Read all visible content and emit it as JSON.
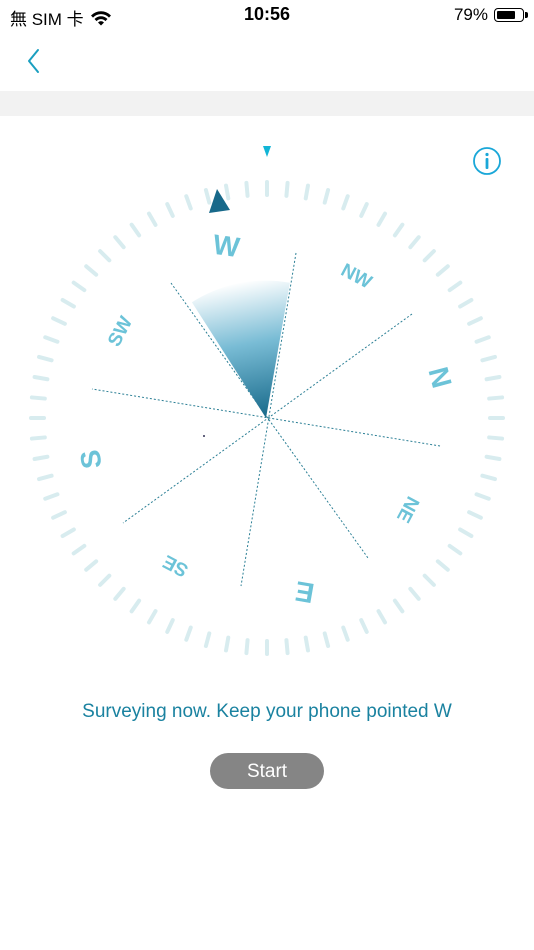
{
  "status_bar": {
    "carrier": "無 SIM 卡",
    "time": "10:56",
    "battery_percent": "79%",
    "battery_level": 0.79
  },
  "nav": {
    "back_icon": "chevron-left-icon"
  },
  "info_icon": "info-circle-icon",
  "compass": {
    "heading": "W",
    "labels": {
      "W": "W",
      "NW": "NW",
      "N": "N",
      "NE": "NE",
      "E": "E",
      "SE": "SE",
      "S": "S",
      "SW": "SW"
    }
  },
  "survey_text": "Surveying now. Keep your phone pointed W",
  "start_label": "Start",
  "colors": {
    "accent": "#1a9fc0",
    "dial_major": "#3aaec8",
    "dial_tick": "#d8ecef",
    "pointer": "#17698a",
    "button_bg": "#858585"
  }
}
